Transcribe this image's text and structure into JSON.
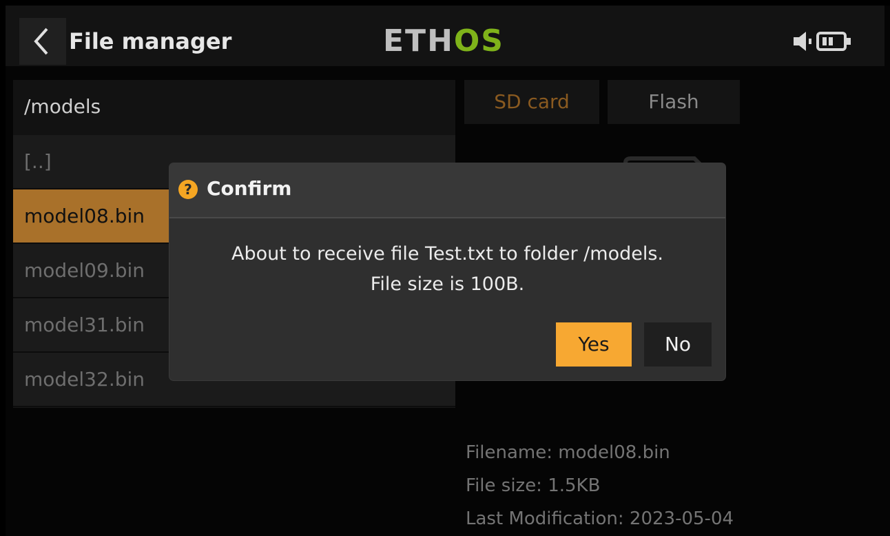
{
  "header": {
    "title": "File manager",
    "logo_left": "ETH",
    "logo_right": "OS",
    "icons": [
      "back-arrow-icon",
      "speaker-icon",
      "battery-icon"
    ]
  },
  "browser": {
    "path": "/models",
    "items": [
      {
        "label": "[..]"
      },
      {
        "label": "model08.bin",
        "selected": true
      },
      {
        "label": "model09.bin"
      },
      {
        "label": "model31.bin"
      },
      {
        "label": "model32.bin"
      }
    ]
  },
  "storage_tabs": {
    "sd": "SD card",
    "flash": "Flash",
    "selected": "SD card"
  },
  "details": {
    "filename": "Filename: model08.bin",
    "size": "File size: 1.5KB",
    "modified": "Last Modification: 2023-05-04"
  },
  "dialog": {
    "title": "Confirm",
    "message_line1": "About to receive file Test.txt to folder /models.",
    "message_line2": "File size is 100B.",
    "yes_label": "Yes",
    "no_label": "No",
    "icon": "question-icon"
  },
  "colors": {
    "accent": "#f7a832",
    "selected_row": "#a9712a",
    "logo_green": "#7fb31a"
  }
}
